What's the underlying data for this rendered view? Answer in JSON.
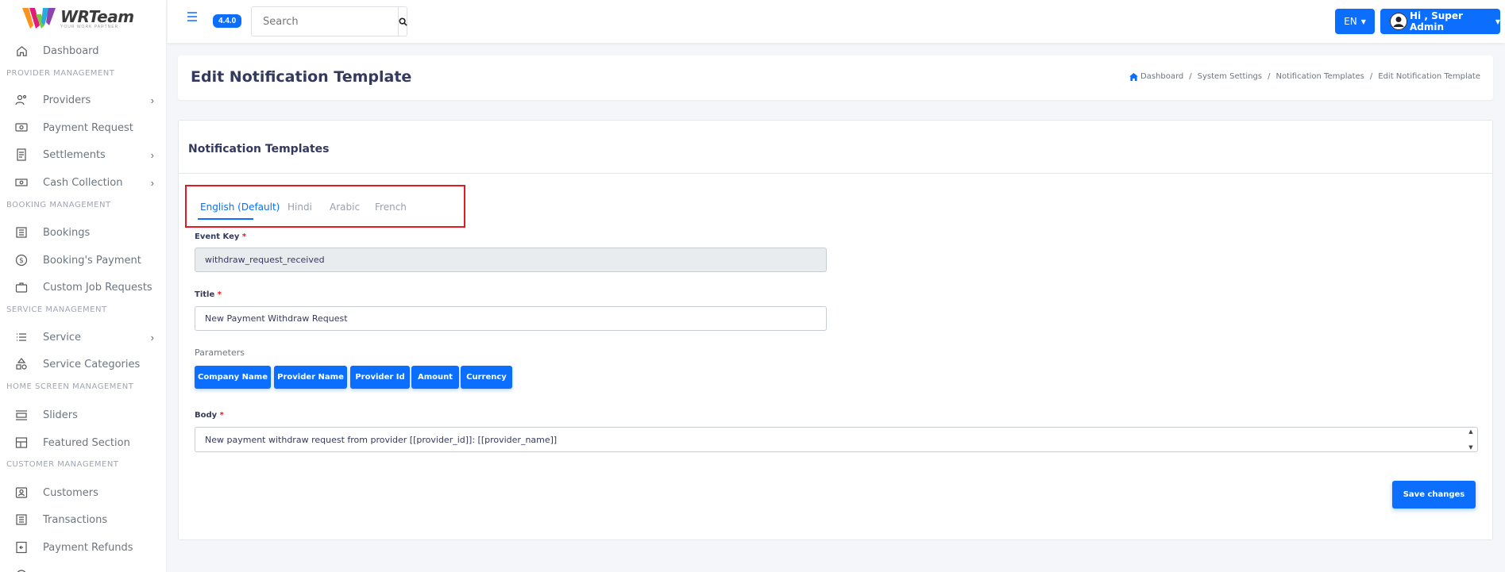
{
  "brand": {
    "name": "WRTeam",
    "tagline": "YOUR WORK PARTNER"
  },
  "sidebar": {
    "items": [
      {
        "label": "Dashboard",
        "icon": "home-icon"
      },
      {
        "section": "PROVIDER MANAGEMENT"
      },
      {
        "label": "Providers",
        "icon": "providers-icon",
        "chevron": true
      },
      {
        "label": "Payment Request",
        "icon": "money-icon"
      },
      {
        "label": "Settlements",
        "icon": "receipt-icon",
        "chevron": true
      },
      {
        "label": "Cash Collection",
        "icon": "cash-icon",
        "chevron": true
      },
      {
        "section": "BOOKING MANAGEMENT"
      },
      {
        "label": "Bookings",
        "icon": "list-icon"
      },
      {
        "label": "Booking's Payment",
        "icon": "dollar-icon"
      },
      {
        "label": "Custom Job Requests",
        "icon": "briefcase-icon"
      },
      {
        "section": "SERVICE MANAGEMENT"
      },
      {
        "label": "Service",
        "icon": "lines-icon",
        "chevron": true
      },
      {
        "label": "Service Categories",
        "icon": "shapes-icon"
      },
      {
        "section": "HOME SCREEN MANAGEMENT"
      },
      {
        "label": "Sliders",
        "icon": "slider-icon"
      },
      {
        "label": "Featured Section",
        "icon": "layout-icon"
      },
      {
        "section": "CUSTOMER MANAGEMENT"
      },
      {
        "label": "Customers",
        "icon": "customer-icon"
      },
      {
        "label": "Transactions",
        "icon": "transactions-icon"
      },
      {
        "label": "Payment Refunds",
        "icon": "refund-icon"
      }
    ]
  },
  "topbar": {
    "version": "4.4.0",
    "search_placeholder": "Search",
    "language": "EN",
    "user": "Hi , Super Admin"
  },
  "header": {
    "title": "Edit Notification Template",
    "breadcrumb": [
      "Dashboard",
      "System Settings",
      "Notification Templates",
      "Edit Notification Template"
    ]
  },
  "card": {
    "title": "Notification Templates",
    "tabs": [
      "English (Default)",
      "Hindi",
      "Arabic",
      "French"
    ],
    "event_key_label": "Event Key",
    "event_key_value": "withdraw_request_received",
    "title_label": "Title",
    "title_value": "New Payment Withdraw Request",
    "parameters_label": "Parameters",
    "parameters": [
      "Company Name",
      "Provider Name",
      "Provider Id",
      "Amount",
      "Currency"
    ],
    "body_label": "Body",
    "body_value": "New payment withdraw request from provider [[provider_id]]: [[provider_name]]",
    "save_label": "Save changes"
  },
  "colors": {
    "primary": "#0b6efd",
    "highlight": "#e01b24"
  }
}
